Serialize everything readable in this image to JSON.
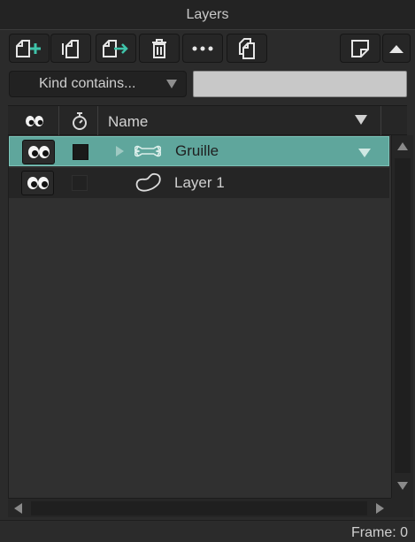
{
  "panel": {
    "title": "Layers"
  },
  "toolbar": {
    "buttons": [
      {
        "name": "new-layer-button",
        "icon": "new-layer-plus-icon"
      },
      {
        "name": "duplicate-layer-button",
        "icon": "duplicate-page-icon"
      },
      {
        "name": "move-layer-button",
        "icon": "move-layer-arrow-icon"
      },
      {
        "name": "delete-layer-button",
        "icon": "trash-icon"
      },
      {
        "name": "more-options-button",
        "icon": "ellipsis-icon"
      },
      {
        "name": "copy-layer-button",
        "icon": "copy-pages-icon"
      },
      {
        "name": "layer-mask-button",
        "icon": "page-corner-icon"
      },
      {
        "name": "collapse-panel-button",
        "icon": "chevron-up-icon"
      }
    ]
  },
  "filter": {
    "kind_label": "Kind contains...",
    "search_value": ""
  },
  "columns": {
    "visibility_icon": "eyes-icon",
    "timing_icon": "stopwatch-icon",
    "name_label": "Name"
  },
  "layers": [
    {
      "name": "Gruille",
      "type_icon": "bone-icon",
      "selected": true,
      "visible": true,
      "checked": true,
      "has_children": true
    },
    {
      "name": "Layer 1",
      "type_icon": "blob-shape-icon",
      "selected": false,
      "visible": true,
      "checked": false,
      "has_children": false
    }
  ],
  "colors": {
    "selected_row": "#5fa69c",
    "accent_icon": "#3fc3a9",
    "background": "#2b2b2b"
  },
  "status": {
    "frame_label": "Frame: 0"
  }
}
